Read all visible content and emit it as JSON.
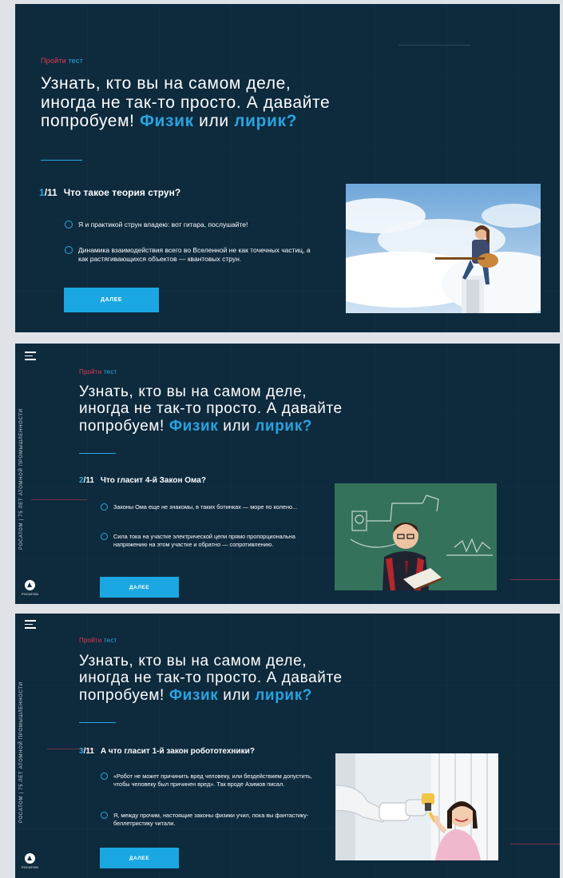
{
  "common": {
    "kicker_part1": "Пройти",
    "kicker_part2": "тест",
    "headline_line1": "Узнать, кто вы на самом деле,",
    "headline_line2": "иногда не так-то просто. А давайте",
    "headline_line3_start": "попробуем!",
    "headline_word_physicist": "Физик",
    "headline_word_or": "или",
    "headline_word_lyricist": "лирик?",
    "next_button": "ДАЛЕЕ",
    "sidebar_text": "РОСАТОМ | 75 ЛЕТ АТОМНОЙ ПРОМЫШЛЕННОСТИ",
    "logo_text": "РОСАТОМ"
  },
  "slides": [
    {
      "number": "1",
      "total": "/11",
      "question": "Что такое теория струн?",
      "options": [
        "Я и практикой струн владею: вот гитара, послушайте!",
        "Динамика взаимодействия всего во Вселенной не как точечных частиц, а как растягивающихся объектов — квантовых струн."
      ],
      "image": "girl-with-guitar-photo"
    },
    {
      "number": "2",
      "total": "/11",
      "question": "Что гласит 4-й Закон Ома?",
      "options": [
        "Законы Ома еще не знакомы, в таких ботинках — море по колено...",
        "Сила тока на участке электрической цепи прямо пропорциональна напряжению на этом участке и обратно — сопротивлению."
      ],
      "image": "boy-reading-at-chalkboard-photo"
    },
    {
      "number": "3",
      "total": "/11",
      "question": "А что гласит 1-й закон робототехники?",
      "options": [
        "«Робот не может причинить вред человеку, или бездействием допустить, чтобы человеку был причинен вред». Так вроде Азимов писал.",
        "Я, между прочим, настоящие законы физики учил, пока вы фантастику-беллетристику читали."
      ],
      "image": "girl-with-robot-arm-photo"
    }
  ],
  "colors": {
    "panel_bg": "#0e2a3d",
    "accent_blue": "#29a3e0",
    "button_blue": "#1ba7e1",
    "kicker_red": "#e8394f"
  }
}
